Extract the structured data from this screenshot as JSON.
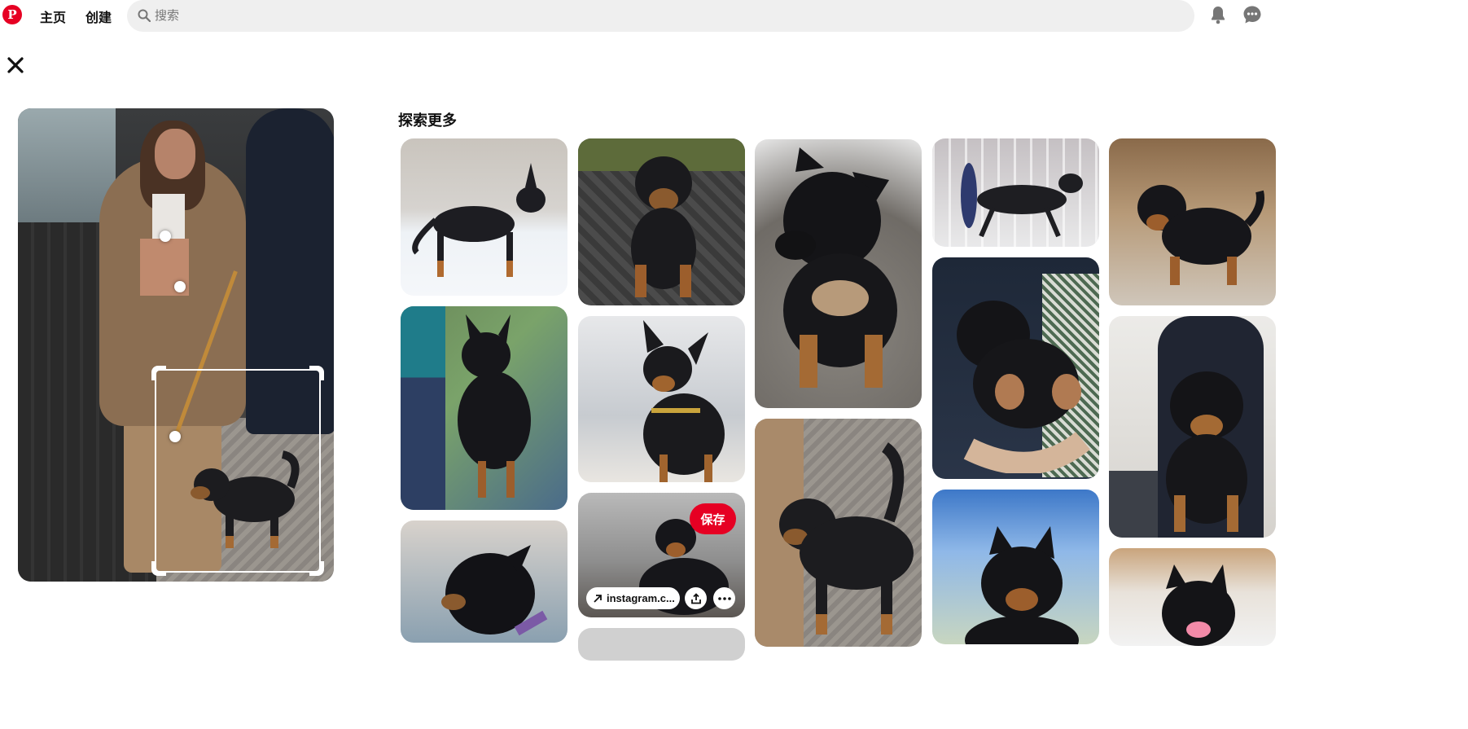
{
  "header": {
    "logo_letter": "P",
    "nav": [
      {
        "label": "主页"
      },
      {
        "label": "创建"
      }
    ],
    "search": {
      "placeholder": "搜索",
      "value": ""
    }
  },
  "explore": {
    "title": "探索更多"
  },
  "hover_pin": {
    "save_label": "保存",
    "link_text": "instagram.c..."
  },
  "colors": {
    "brand": "#e60023",
    "search_bg": "#efefef"
  },
  "icons": [
    "pinterest-logo-icon",
    "search-icon",
    "bell-icon",
    "chat-icon",
    "close-icon",
    "share-icon",
    "more-icon",
    "arrow-link-icon"
  ]
}
